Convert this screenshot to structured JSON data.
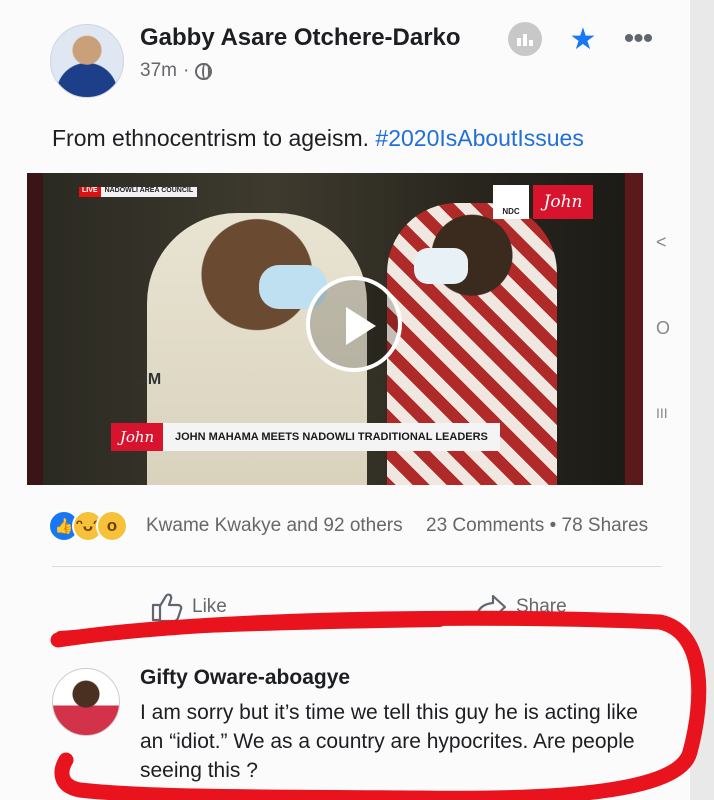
{
  "post": {
    "author": "Gabby Asare Otchere-Darko",
    "time": "37m",
    "separator": "·",
    "text": "From ethnocentrism to ageism.",
    "hashtag": "#2020IsAboutIssues"
  },
  "header_icons": [
    "stats-icon",
    "star-icon",
    "more-icon"
  ],
  "video": {
    "live_label": "LIVE",
    "location_label": "NADOWLI AREA COUNCIL",
    "ndc_label": "NDC",
    "channel_logo": "John",
    "shirt_text": "JM",
    "lower_third_logo": "John",
    "caption": "JOHN MAHAMA MEETS NADOWLI TRADITIONAL LEADERS"
  },
  "side_nav": {
    "back": "<",
    "home": "O",
    "recents": "III"
  },
  "engagement": {
    "reactors": "Kwame Kwakye and 92 others",
    "comments": "23 Comments",
    "dot": "•",
    "shares": "78 Shares"
  },
  "actions": {
    "like_label": "Like",
    "share_label": "Share"
  },
  "comment": {
    "author": "Gifty Oware-aboagye",
    "text": "I am sorry but it’s time we tell this guy he is acting like an “idiot.” We as a country are hypocrites. Are people seeing this ?"
  },
  "colors": {
    "accent": "#1877f2",
    "hashtag": "#216fdb",
    "highlight": "#e8131d"
  }
}
